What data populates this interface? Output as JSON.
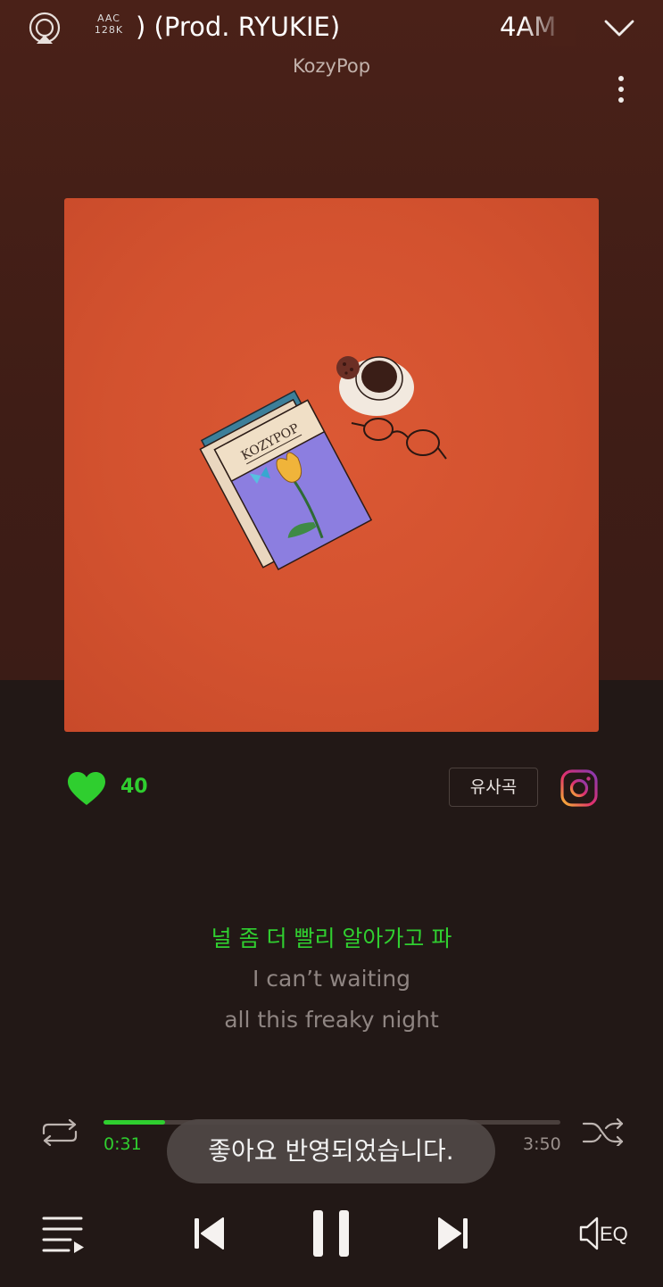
{
  "header": {
    "format_top": "AAC",
    "format_bottom": "128K",
    "title_text": ") (Prod. RYUKIE)",
    "title_next_text": "4AM (",
    "artist": "KozyPop",
    "icons": [
      "airplay-icon",
      "chevron-down-icon",
      "more-vertical-icon"
    ]
  },
  "album": {
    "cover_text": "KOZYPOP"
  },
  "actions": {
    "like_count": "40",
    "similar_label": "유사곡",
    "icons": [
      "heart-icon",
      "instagram-icon"
    ]
  },
  "lyrics": {
    "current": "널 좀 더 빨리 알아가고 파",
    "next_1": "I can’t waiting",
    "next_2": "all this freaky night"
  },
  "progress": {
    "current_time": "0:31",
    "total_time": "3:50",
    "fraction": 0.135
  },
  "toast": {
    "message": "좋아요 반영되었습니다."
  },
  "controls": {
    "eq_label": "EQ",
    "icons": [
      "playlist-icon",
      "previous-icon",
      "pause-icon",
      "next-icon",
      "repeat-icon",
      "shuffle-icon",
      "sound-eq-icon"
    ]
  },
  "colors": {
    "accent": "#2fce2f",
    "top_background": "#4a2118",
    "bottom_background": "#221816",
    "album_background": "#d3522f"
  }
}
